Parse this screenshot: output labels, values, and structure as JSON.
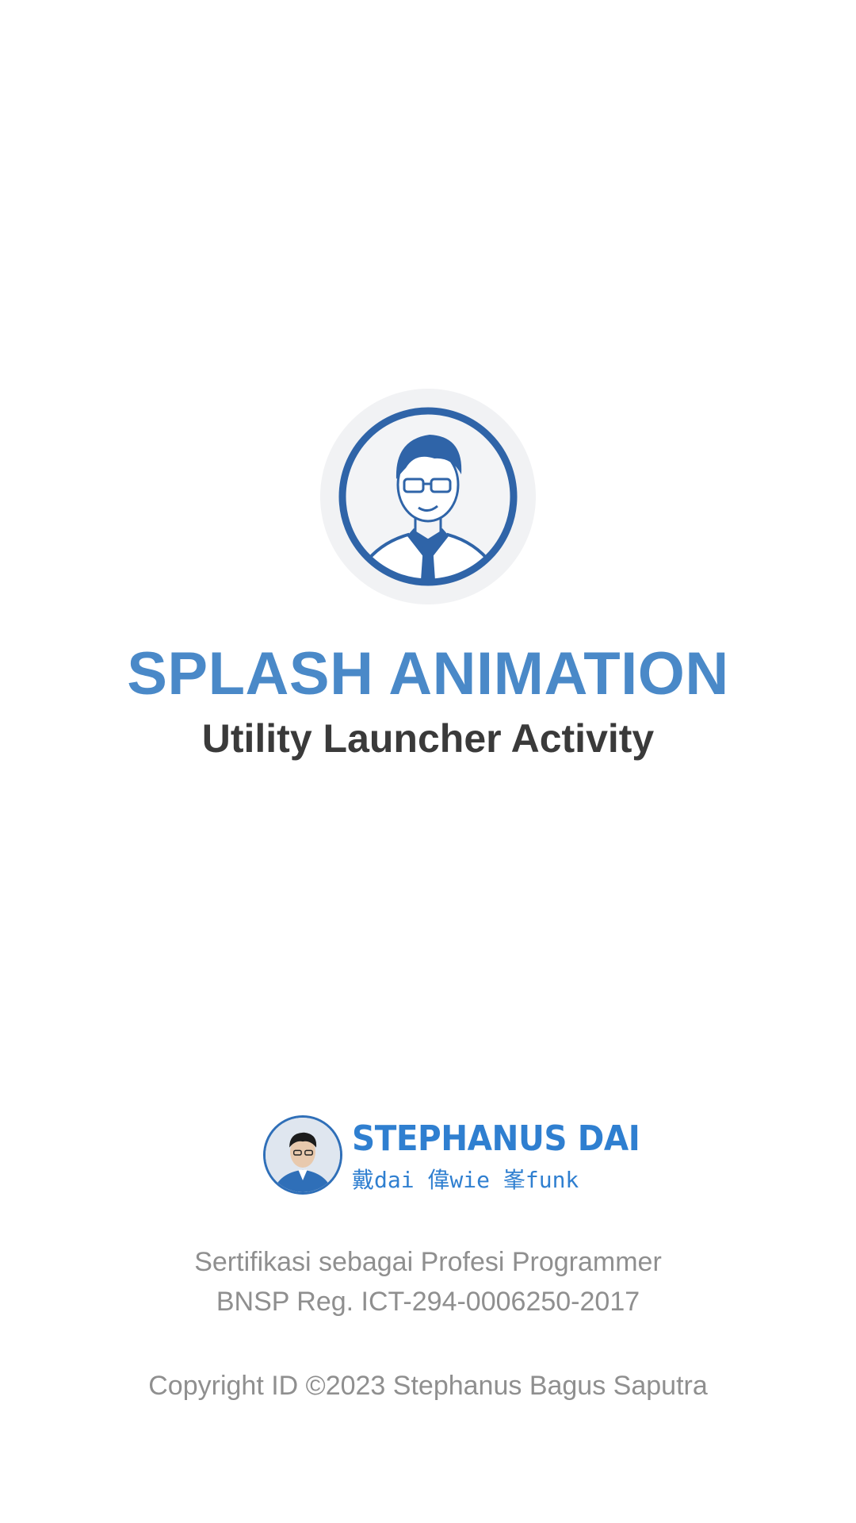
{
  "splash": {
    "title": "SPLASH ANIMATION",
    "subtitle": "Utility Launcher Activity"
  },
  "brand": {
    "name": "STEPHANUS DAI",
    "tagline": "戴dai 偉wie 峯funk"
  },
  "certification": {
    "line1": "Sertifikasi sebagai Profesi Programmer",
    "line2": "BNSP Reg. ICT-294-0006250-2017"
  },
  "copyright": "Copyright ID ©2023 Stephanus Bagus Saputra",
  "colors": {
    "accent": "#4a89c8",
    "brand": "#2f7fd0",
    "portrait": "#2f64a8",
    "text_dark": "#3a3a3a",
    "text_muted": "#8f8f8f"
  },
  "icons": {
    "avatar": "portrait-illustration-icon",
    "brand_avatar": "brand-avatar-icon"
  }
}
